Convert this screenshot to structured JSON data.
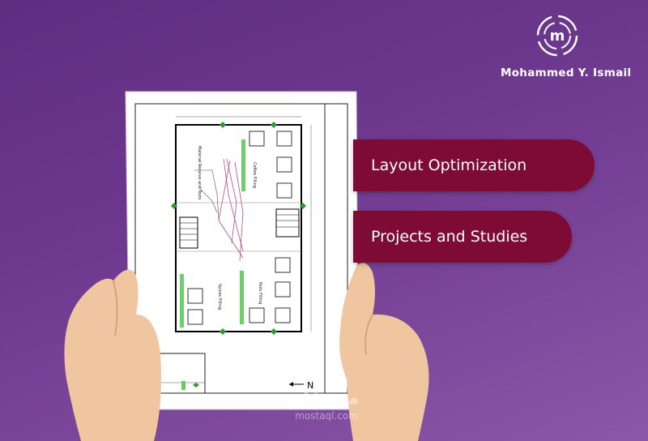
{
  "brand": {
    "name": "Mohammed Y. Ismail",
    "logo_letter": "m"
  },
  "cards": [
    {
      "label": "Layout Optimization",
      "color": "#7d0b33"
    },
    {
      "label": "Projects and Studies",
      "color": "#7d0b33"
    }
  ],
  "plan": {
    "zones": [
      "Material Receive and Tests",
      "Coffee Filling",
      "Spices Filling",
      "Nuts Filling"
    ],
    "north_label": "N"
  },
  "watermark": {
    "arabic": "مستقل",
    "latin": "mostaql.com"
  }
}
